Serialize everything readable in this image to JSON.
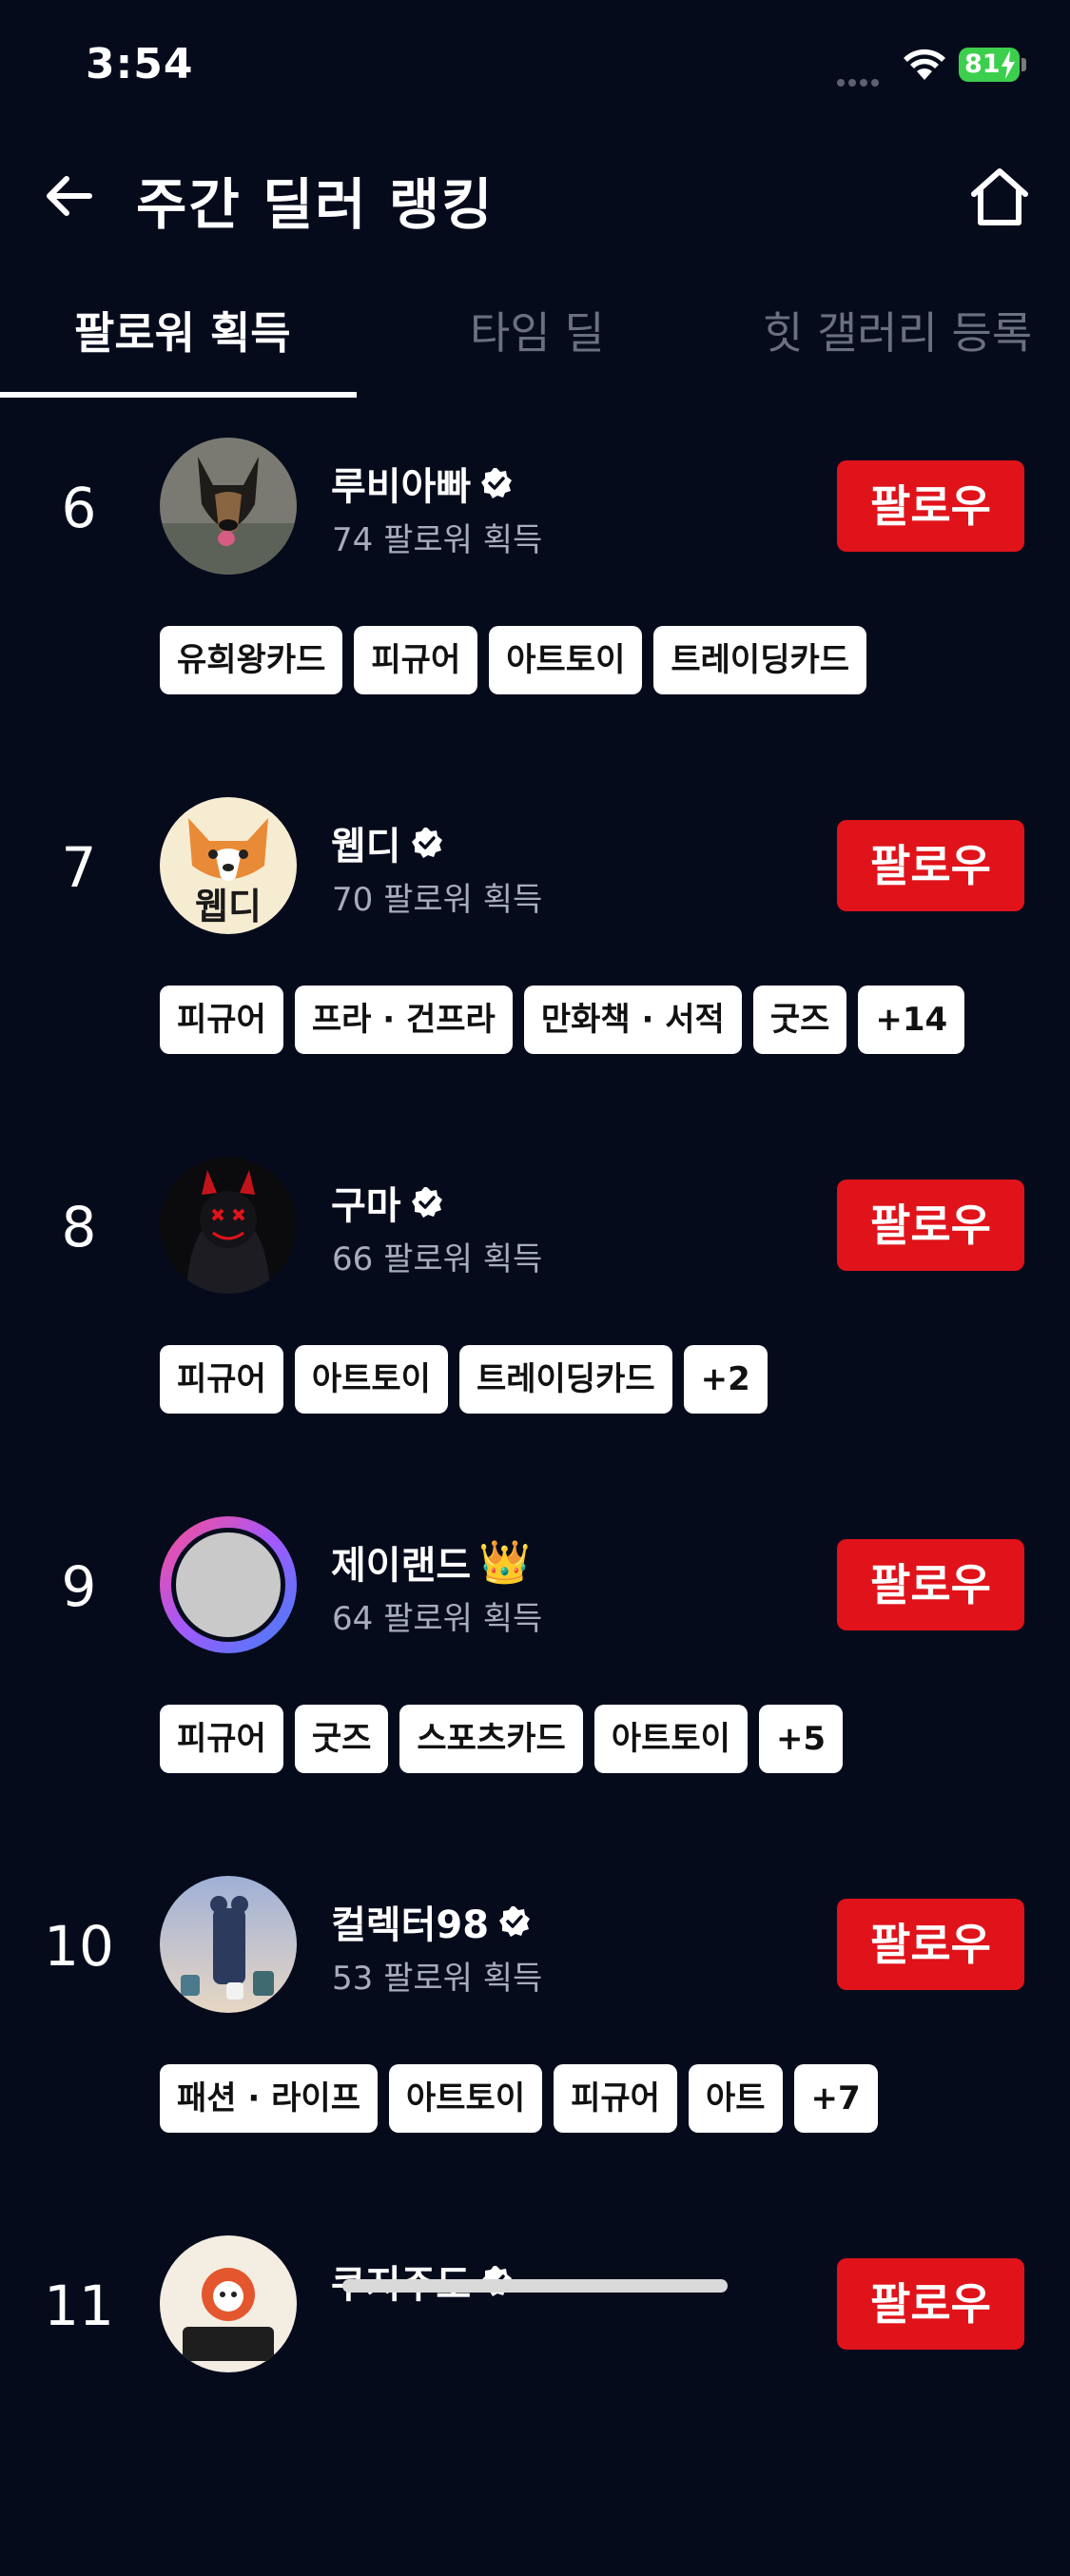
{
  "status_bar": {
    "time": "3:54",
    "battery": "81"
  },
  "header": {
    "title": "주간 딜러 랭킹"
  },
  "tabs": [
    {
      "label": "팔로워 획득",
      "active": true
    },
    {
      "label": "타임 딜",
      "active": false
    },
    {
      "label": "힛 갤러리 등록",
      "active": false
    }
  ],
  "entries": [
    {
      "rank": "6",
      "name": "루비아빠",
      "badge": "verified",
      "count": "74 팔로워 획득",
      "follow": "팔로우",
      "tags": [
        "유희왕카드",
        "피규어",
        "아트토이",
        "트레이딩카드"
      ]
    },
    {
      "rank": "7",
      "name": "웹디",
      "badge": "verified",
      "count": "70 팔로워 획득",
      "follow": "팔로우",
      "avatar_text": "웹디",
      "tags": [
        "피규어",
        "프라 · 건프라",
        "만화책 · 서적",
        "굿즈",
        "+14"
      ]
    },
    {
      "rank": "8",
      "name": "구마",
      "badge": "verified",
      "count": "66 팔로워 획득",
      "follow": "팔로우",
      "tags": [
        "피규어",
        "아트토이",
        "트레이딩카드",
        "+2"
      ]
    },
    {
      "rank": "9",
      "name": "제이랜드",
      "badge": "crown",
      "badge_icon": "👑",
      "count": "64 팔로워 획득",
      "follow": "팔로우",
      "tags": [
        "피규어",
        "굿즈",
        "스포츠카드",
        "아트토이",
        "+5"
      ]
    },
    {
      "rank": "10",
      "name": "컬렉터98",
      "badge": "verified",
      "count": "53 팔로워 획득",
      "follow": "팔로우",
      "tags": [
        "패션 · 라이프",
        "아트토이",
        "피규어",
        "아트",
        "+7"
      ]
    },
    {
      "rank": "11",
      "name": "쿠지주도",
      "badge": "verified",
      "count": "",
      "follow": "팔로우",
      "tags": []
    }
  ],
  "colors": {
    "background": "#060b1c",
    "accent": "#e0131a",
    "muted_text": "#a9adba"
  }
}
